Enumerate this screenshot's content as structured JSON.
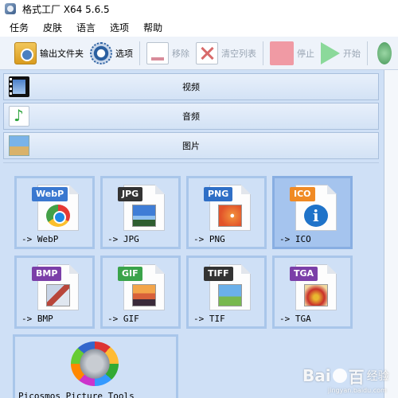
{
  "window": {
    "title": "格式工厂 X64 5.6.5"
  },
  "menu": [
    "任务",
    "皮肤",
    "语言",
    "选项",
    "帮助"
  ],
  "toolbar": {
    "output_folder": "输出文件夹",
    "options": "选项",
    "remove": "移除",
    "clear_list": "清空列表",
    "stop": "停止",
    "start": "开始"
  },
  "categories": {
    "video": "视频",
    "audio": "音频",
    "image": "图片"
  },
  "tiles": [
    {
      "tag": "WebP",
      "label": "-> WebP",
      "tag_color": "#3a78d0"
    },
    {
      "tag": "JPG",
      "label": "-> JPG",
      "tag_color": "#333333"
    },
    {
      "tag": "PNG",
      "label": "-> PNG",
      "tag_color": "#2f6fc6"
    },
    {
      "tag": "ICO",
      "label": "-> ICO",
      "tag_color": "#f08a24"
    },
    {
      "tag": "BMP",
      "label": "-> BMP",
      "tag_color": "#7b3fa8"
    },
    {
      "tag": "GIF",
      "label": "-> GIF",
      "tag_color": "#3aa34a"
    },
    {
      "tag": "TIFF",
      "label": "-> TIF",
      "tag_color": "#333333"
    },
    {
      "tag": "TGA",
      "label": "-> TGA",
      "tag_color": "#7b3fa8"
    }
  ],
  "selected_tile": "ICO",
  "picture_tool": {
    "label": "Picosmos Picture Tools"
  },
  "watermark": {
    "logo": "Bai",
    "logo_suffix": "百",
    "text": "经验",
    "url": "jingyan.baidu.com"
  }
}
